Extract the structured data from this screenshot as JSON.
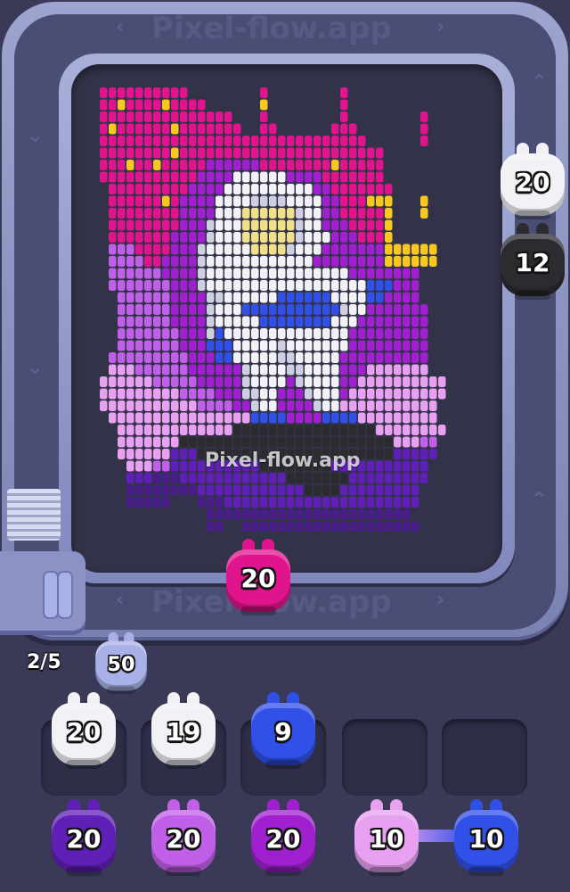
{
  "watermark": "Pixel-flow.app",
  "progress": {
    "label": "2/5",
    "current": 2,
    "total": 5
  },
  "colors": {
    "pink": "#e0148c",
    "white": "#f2f2f6",
    "black": "#2c2c30",
    "blue": "#3050e8",
    "indigo": "#6020b8",
    "lavender": "#c060e8",
    "magenta": "#a020d0",
    "lightpink": "#e8a0f0",
    "periwinkle": "#a8b0e8",
    "yellow": "#f8c820",
    "darkpurple": "#4a1e8a",
    "gray": "#cfcfe2"
  },
  "track_shooters": [
    {
      "name": "track-shooter-white",
      "value": "20",
      "color": "white"
    },
    {
      "name": "track-shooter-black",
      "value": "12",
      "color": "black"
    },
    {
      "name": "track-shooter-pink",
      "value": "20",
      "color": "pink"
    }
  ],
  "loader_shooter": {
    "value": "50",
    "color": "periwinkle"
  },
  "queue_shooters": [
    {
      "name": "queue-shooter-white-1",
      "value": "20",
      "color": "white"
    },
    {
      "name": "queue-shooter-white-2",
      "value": "19",
      "color": "white"
    },
    {
      "name": "queue-shooter-blue",
      "value": "9",
      "color": "blue"
    }
  ],
  "bottom_shooters": [
    {
      "name": "bottom-shooter-indigo",
      "value": "20",
      "color": "indigo"
    },
    {
      "name": "bottom-shooter-lavender",
      "value": "20",
      "color": "lavender"
    },
    {
      "name": "bottom-shooter-magenta",
      "value": "20",
      "color": "magenta"
    },
    {
      "name": "bottom-shooter-lightpink",
      "value": "10",
      "color": "lightpink"
    },
    {
      "name": "bottom-shooter-blue",
      "value": "10",
      "color": "blue"
    }
  ],
  "pixel_art": {
    "palette": {
      "P": "#e0148c",
      "Y": "#f8c820",
      "V": "#a020d0",
      "L": "#c060e8",
      "M": "#e8a0f0",
      "W": "#f2f2f6",
      "G": "#cfcfe2",
      "S": "#f0e08a",
      "B": "#3050e8",
      "K": "#2c2c30",
      "D": "#4a1e8a",
      "I": "#6020b8"
    },
    "rows": [
      ".PPPPPPPPPP........P........P..........",
      ".PPYPPPPYPPPP......Y........P..........",
      ".PPPPPPPPPPPPPPP...P........P........P.",
      ".PYPPPPPPYPPPPPPP..PP......PPP.......P.",
      ".PPPPPPPPPPPPPPPPPPPPPPPPPPPPPP......P.",
      ".PPPPPPPPYPPPPPPPPPPPPPPPPPPPPPPP......",
      ".PPPYPPYPPPPPVVVVVVPPPPPPPPYPPPPP......",
      ".PPPPPPPPPPPVVVVWWWWWWVVVVPPPPPPP......",
      "..PPPPPPPPPVVVVWWWWWWWWWWVVPPPPPPP.....",
      "..PPPPPPYPVVVVWWWWGGGGWWWWVVPPPYYY...Y.",
      "..PPPPPPPPVVVVWWWSSSSSSGWWVVPPPPPY...Y.",
      "..PPPPPPPPVVVGWWWSSSSSSGWWVVVPPPPY.....",
      "..PPPPPPPVVVVGWWWSSSSSSGWWWVVVPPPY.....",
      "..LLLPPPPVVVGWWWWWSSSSGWWWVVVVVVVYYYYYY",
      "..LLLLPPVVVVGWWWWWWWWWWWWVVVVVVVVYYYYYY",
      "..LLLLLLVVVVGWWWWWWWWWWWWWWWWVVVVVVVV..",
      "..LLLLLLLVVVGWWWWWWWWWWWWWWWWWWBBBVVV..",
      "...LLLLLLVVVVGGWWWWWWBBBBBBWWWWBBVVVV..",
      "...LLLLLLVVVVGWWWBBBBBBBBBBBGWWVVVVVVV.",
      "...LLLLLLVVVVGWWWWWBBBBBBBBWWWVVVVVVVV.",
      "...LLLLLLLVVVGBWWWWWWWWWWWWWWVVVVVVVVV.",
      "...LLLLLLLVVVBBBWWWWWGWWWWWWWVVVVVVVVV.",
      "..LLLLLLLLLVVVBBWWWWWGGWWWWWVVVVVVVVVV.",
      "..MMMLLLLLLVVVVVVGWWWWGGWWWWVVVMMMMMMM.",
      ".MMMMMMLLLLLVVVVVGWWWWVGWWWWVVMMMMMMMMMM",
      ".MMMMMMMMMLLLLVVVGGWWVVVGWWWVMMMMMMMMMMM",
      ".MMMMMMMMMMMLLLLVVGWWVVVVGWWMMMMMMMMMMM.",
      "..MMMMMMMMMMMMMMMMBBBBVVVVBBBBMMMMMMMMM.",
      "...MMMMMMMMMMMMMKKKKKKKKKKKKKKKKMMMMMMMM",
      "...MMMMMMMKKKKKKKKKKKKKKKKKKKKKKKKMMMLL.",
      "...MMMMMMIIIKKKKKKKKKKKKKKKKKKKKKKIIIII.",
      "....MMMLLIIIIIIIIIIKKKKKKKKIIIIIIIIIII..",
      "....IIIDDDIIIIIIIIIIIIKKKKKKKIIIIIIIII..",
      "....DDDDDDDDIIIIIIIIIIIIKKKKIIIIIIIII...",
      "....DDDDD...DDDIIIIIIIIIIIIIIIIIIIIII...",
      ".............DDDDDDDDDDDDDDDDDDDDDDD....",
      ".............DD..DDDDDDDDDDDDDDDDDDDD..."
    ]
  }
}
